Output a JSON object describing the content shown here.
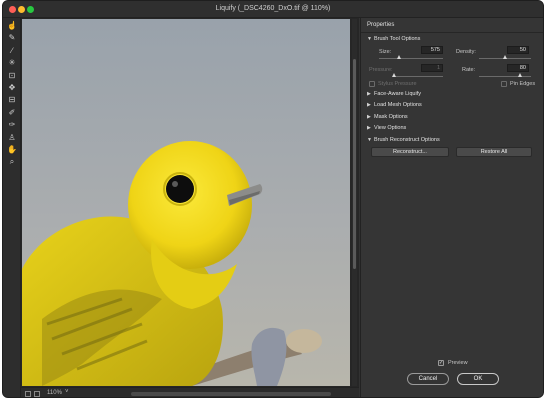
{
  "window": {
    "title": "Liquify (_DSC4260_DxO.tif @ 110%)"
  },
  "toolbar": {
    "tools": [
      {
        "name": "forward-warp-tool",
        "icon": "warp-finger-icon",
        "glyph": "☝"
      },
      {
        "name": "reconstruct-tool",
        "icon": "reconstruct-brush-icon",
        "glyph": "✎"
      },
      {
        "name": "smooth-tool",
        "icon": "smooth-brush-icon",
        "glyph": "∕"
      },
      {
        "name": "twirl-clockwise-tool",
        "icon": "twirl-icon",
        "glyph": "✳"
      },
      {
        "name": "pucker-tool",
        "icon": "pucker-icon",
        "glyph": "⊡"
      },
      {
        "name": "bloat-tool",
        "icon": "bloat-icon",
        "glyph": "✥"
      },
      {
        "name": "push-left-tool",
        "icon": "push-left-icon",
        "glyph": "⊟"
      },
      {
        "name": "freeze-mask-tool",
        "icon": "freeze-mask-icon",
        "glyph": "✐"
      },
      {
        "name": "thaw-mask-tool",
        "icon": "thaw-mask-icon",
        "glyph": "✑"
      },
      {
        "name": "face-tool",
        "icon": "face-icon",
        "glyph": "♙"
      },
      {
        "name": "hand-tool",
        "icon": "hand-icon",
        "glyph": "✋"
      },
      {
        "name": "zoom-tool",
        "icon": "magnifier-icon",
        "glyph": "⌕"
      }
    ]
  },
  "status": {
    "zoom": "110%",
    "zoom_arrow": "˅"
  },
  "panel": {
    "title": "Properties",
    "brush_tool_options": {
      "label": "Brush Tool Options",
      "size_label": "Size:",
      "size_value": "575",
      "size_level": 0.32,
      "density_label": "Density:",
      "density_value": "50",
      "density_level": 0.5,
      "pressure_label": "Pressure:",
      "pressure_value": "1",
      "pressure_level": 0.02,
      "rate_label": "Rate:",
      "rate_value": "80",
      "rate_level": 0.8,
      "stylus_pressure_label": "Stylus Pressure",
      "pin_edges_label": "Pin Edges"
    },
    "sections": [
      {
        "name": "face-aware-liquify-section",
        "label": "Face-Aware Liquify"
      },
      {
        "name": "load-mesh-options-section",
        "label": "Load Mesh Options"
      },
      {
        "name": "mask-options-section",
        "label": "Mask Options"
      },
      {
        "name": "view-options-section",
        "label": "View Options"
      }
    ],
    "brush_reconstruct": {
      "label": "Brush Reconstruct Options",
      "reconstruct_label": "Reconstruct...",
      "restore_all_label": "Restore All"
    },
    "preview_label": "Preview",
    "preview_checked": true,
    "cancel_label": "Cancel",
    "ok_label": "OK"
  },
  "colors": {
    "window_bg": "#323232",
    "panel_bg": "#353535",
    "bird_yellow": "#f2de1a",
    "sky_top": "#9da5ad",
    "sky_bottom": "#b7b6ad"
  }
}
